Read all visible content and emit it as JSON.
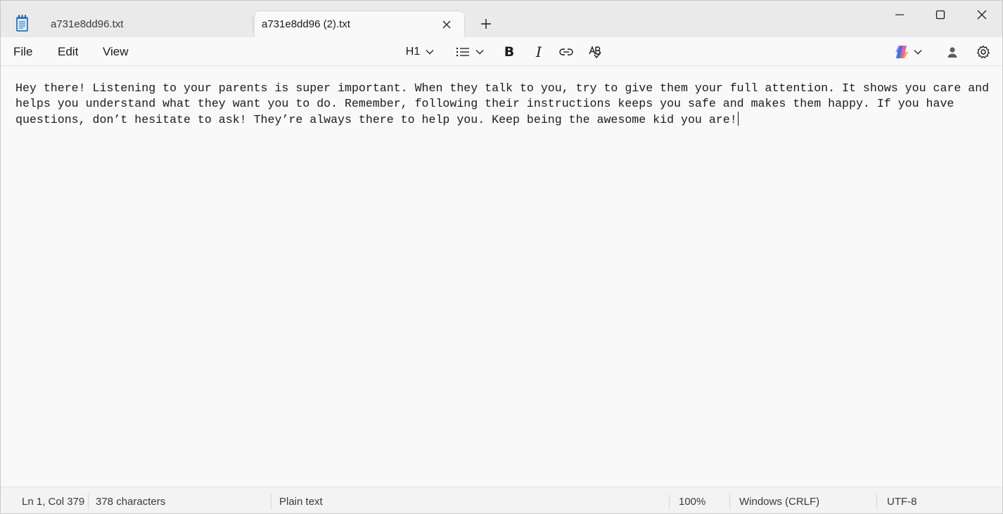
{
  "window": {
    "tabs": [
      {
        "label": "a731e8dd96.txt",
        "active": false
      },
      {
        "label": "a731e8dd96 (2).txt",
        "active": true
      }
    ],
    "icons": {
      "app": "notepad-icon",
      "close_tab": "close-icon",
      "new_tab": "plus-icon",
      "minimize": "minimize-icon",
      "maximize": "maximize-icon",
      "close_window": "close-icon"
    }
  },
  "menu": {
    "file": "File",
    "edit": "Edit",
    "view": "View"
  },
  "toolbar": {
    "heading": "H1",
    "bold": "B",
    "italic": "I",
    "icons": [
      "chevron-down-icon",
      "list-icon",
      "link-icon",
      "spellcheck-icon",
      "copilot-icon",
      "account-icon",
      "gear-icon"
    ]
  },
  "editor": {
    "text": "Hey there! Listening to your parents is super important. When they talk to you, try to give them your full attention. It shows you care and helps you understand what they want you to do. Remember, following their instructions keeps you safe and makes them happy. If you have questions, don’t hesitate to ask! They’re always there to help you. Keep being the awesome kid you are!"
  },
  "status": {
    "position": "Ln 1, Col 379",
    "characters": "378 characters",
    "format": "Plain text",
    "zoom": "100%",
    "line_ending": "Windows (CRLF)",
    "encoding": "UTF-8"
  },
  "colors": {
    "copilot_blue": "#2b7de9",
    "copilot_pink": "#e3489a",
    "copilot_orange": "#f6a623"
  }
}
